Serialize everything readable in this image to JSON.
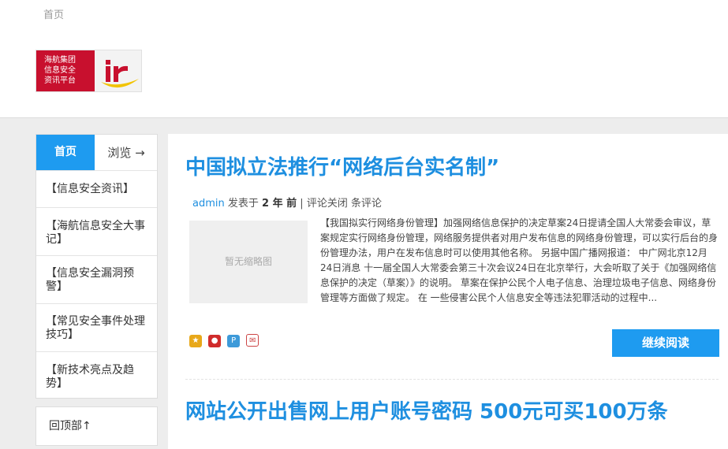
{
  "header": {
    "top_link": "首页",
    "logo": {
      "lines": [
        "海航集团",
        "信息安全",
        "资讯平台"
      ],
      "mark": "ir"
    }
  },
  "sidebar": {
    "tab_home": "首页",
    "tab_browse": "浏览 →",
    "items": [
      {
        "label": "【信息安全资讯】"
      },
      {
        "label": "【海航信息安全大事记】"
      },
      {
        "label": "【信息安全漏洞预警】"
      },
      {
        "label": "【常见安全事件处理技巧】"
      },
      {
        "label": "【新技术亮点及趋势】"
      }
    ],
    "back_to_top": "回顶部↑"
  },
  "posts": [
    {
      "title": "中国拟立法推行“网络后台实名制”",
      "meta": {
        "author": "admin",
        "posted_label": "发表于",
        "time": "2 年 前",
        "separator": "|",
        "comments_closed": "评论关闭",
        "comment_count_label": "条评论"
      },
      "thumbnail_text": "暂无缩略图",
      "excerpt": "【我国拟实行网络身份管理】加强网络信息保护的决定草案24日提请全国人大常委会审议，草案规定实行网络身份管理，网络服务提供者对用户发布信息的网络身份管理，可以实行后台的身份管理办法，用户在发布信息时可以使用其他名称。 另据中国广播网报道： 中广网北京12月24日消息 十一届全国人大常委会第三十次会议24日在北京举行，大会听取了关于《加强网络信息保护的决定（草案）》的说明。 草案在保护公民个人电子信息、治理垃圾电子信息、网络身份管理等方面做了规定。 在 一些侵害公民个人信息安全等违法犯罪活动的过程中...",
      "read_more": "继续阅读",
      "share_icons": [
        "qzone-icon",
        "weibo-icon",
        "pengyou-icon",
        "mail-icon"
      ]
    },
    {
      "title": "网站公开出售网上用户账号密码 500元可买100万条"
    }
  ],
  "colors": {
    "accent": "#1e9bf0",
    "title": "#1e8fe0",
    "logo_red": "#c8102e"
  }
}
